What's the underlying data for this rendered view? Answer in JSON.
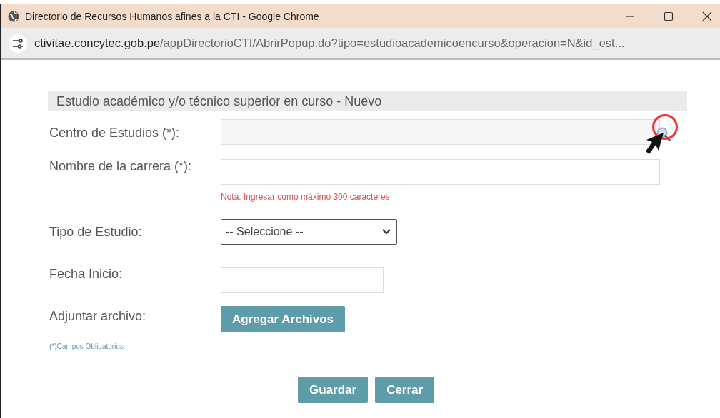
{
  "window": {
    "title": "Directorio de Recursos Humanos afines a la CTI - Google Chrome"
  },
  "address_bar": {
    "host": "ctivitae.concytec.gob.pe",
    "path": "/appDirectorioCTI/AbrirPopup.do?tipo=estudioacademicoencurso&operacion=N&id_est..."
  },
  "form": {
    "heading": "Estudio académico y/o técnico superior en curso - Nuevo",
    "fields": [
      {
        "kind": "search",
        "label": "Centro de Estudios (*):",
        "highlighted": true
      },
      {
        "kind": "text",
        "label": "Nombre de la carrera (*):",
        "note": "Nota: Ingresar como máximo 300 caracteres"
      },
      {
        "kind": "select",
        "label": "Tipo de Estudio:",
        "value": "-- Seleccione --"
      },
      {
        "kind": "date",
        "label": "Fecha Inicio:"
      },
      {
        "kind": "file",
        "label": "Adjuntar archivo:",
        "button": "Agregar Archivos"
      }
    ],
    "required_note": "(*)Campos Obligatorios",
    "buttons": [
      "Guardar",
      "Cerrar"
    ]
  }
}
